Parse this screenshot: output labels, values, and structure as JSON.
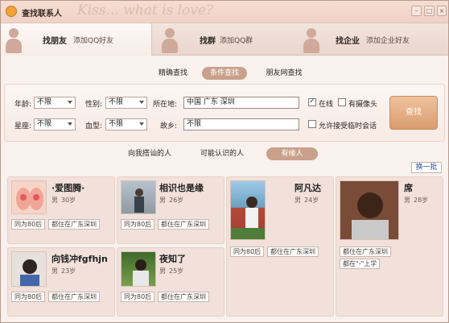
{
  "window": {
    "title": "查找联系人",
    "title_deco": "Kiss... what is love?",
    "min_glyph": "–",
    "max_glyph": "□",
    "close_glyph": "×"
  },
  "top_tabs": [
    {
      "name": "找朋友",
      "sub": "添加QQ好友"
    },
    {
      "name": "找群",
      "sub": "添加QQ群"
    },
    {
      "name": "找企业",
      "sub": "添加企业好友"
    }
  ],
  "search_tabs": [
    "精确查找",
    "条件查找",
    "朋友网查找"
  ],
  "filters": {
    "age_label": "年龄:",
    "age_value": "不限",
    "gender_label": "性别:",
    "gender_value": "不限",
    "location_label": "所在地:",
    "location_value": "中国 广东 深圳",
    "online_label": "在线",
    "camera_label": "有摄像头",
    "constellation_label": "星座:",
    "constellation_value": "不限",
    "blood_label": "血型:",
    "blood_value": "不限",
    "hometown_label": "故乡:",
    "hometown_value": "不限",
    "temp_chat_label": "允许接受临时会话",
    "search_button": "查找"
  },
  "rec_tabs": [
    "向我搭讪的人",
    "可能认识的人",
    "有缘人"
  ],
  "refresh_label": "换一批",
  "cards": [
    {
      "name": "·爱图腾·",
      "gender": "男",
      "age": "30岁",
      "tags": [
        "同为80后",
        "都住在广东深圳"
      ]
    },
    {
      "name": "相识也是缘",
      "gender": "男",
      "age": "26岁",
      "tags": [
        "同为80后",
        "都住在广东深圳"
      ]
    },
    {
      "name": "阿凡达",
      "gender": "男",
      "age": "24岁",
      "tags": [
        "同为80后",
        "都住在广东深圳"
      ]
    },
    {
      "name": "席",
      "gender": "男",
      "age": "28岁",
      "tags": [
        "都住在广东深圳",
        "都在\"-\"上学"
      ]
    },
    {
      "name": "向钱冲fgfhjn",
      "gender": "男",
      "age": "23岁",
      "tags": [
        "同为80后",
        "都住在广东深圳"
      ]
    },
    {
      "name": "夜知了",
      "gender": "男",
      "age": "25岁",
      "tags": [
        "同为80后",
        "都住在广东深圳"
      ]
    }
  ],
  "colors": {
    "accent": "#c9a08a",
    "background": "#f8f1ee",
    "card": "#f1e1da",
    "link": "#2c54a0"
  }
}
